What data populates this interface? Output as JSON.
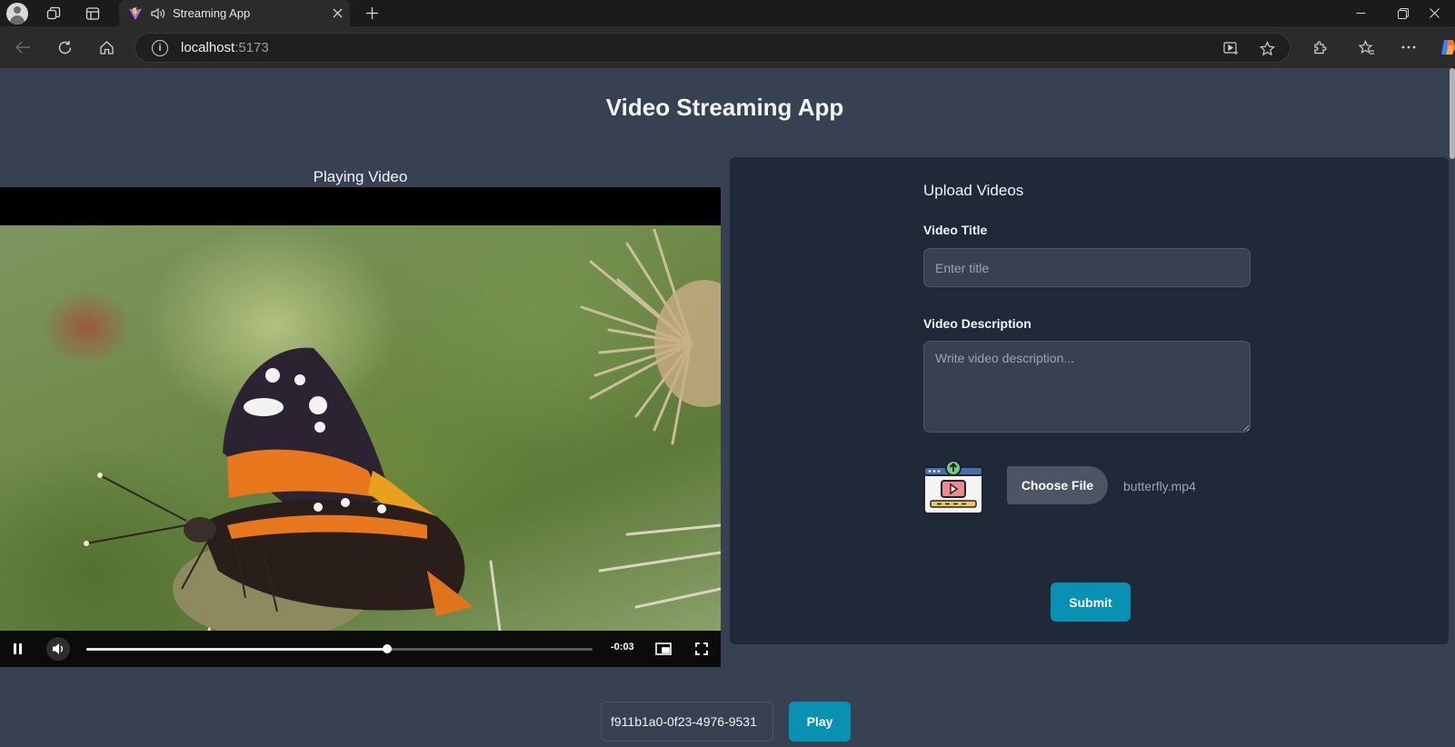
{
  "browser": {
    "tab_title": "Streaming App",
    "address_host": "localhost",
    "address_port": ":5173",
    "icons": [
      "profile-icon",
      "workspaces-icon",
      "tab-actions-icon",
      "vite-favicon",
      "speaker-icon",
      "close-icon",
      "new-tab-icon",
      "minimize-icon",
      "restore-icon",
      "close-window-icon",
      "back-icon",
      "refresh-icon",
      "home-icon",
      "site-info-icon",
      "app-available-icon",
      "favorite-star-icon",
      "extensions-icon",
      "favorites-icon",
      "more-icon",
      "copilot-icon"
    ]
  },
  "page": {
    "title": "Video Streaming App",
    "player": {
      "label": "Playing Video",
      "time_remaining": "-0:03",
      "progress": 0.595,
      "state": "playing",
      "video_subject": "butterfly on thistle"
    },
    "upload": {
      "heading": "Upload Videos",
      "title_label": "Video Title",
      "title_placeholder": "Enter title",
      "title_value": "",
      "description_label": "Video Description",
      "description_placeholder": "Write video description...",
      "description_value": "",
      "choose_file_label": "Choose File",
      "file_name": "butterfly.mp4",
      "submit_label": "Submit"
    },
    "play_bar": {
      "video_id": "f911b1a0-0f23-4976-9531",
      "play_label": "Play"
    }
  },
  "colors": {
    "page_bg": "#374151",
    "card_bg": "#1f2937",
    "accent": "#0891b2",
    "input_bg": "#374151",
    "secondary_button": "#4b5563"
  }
}
